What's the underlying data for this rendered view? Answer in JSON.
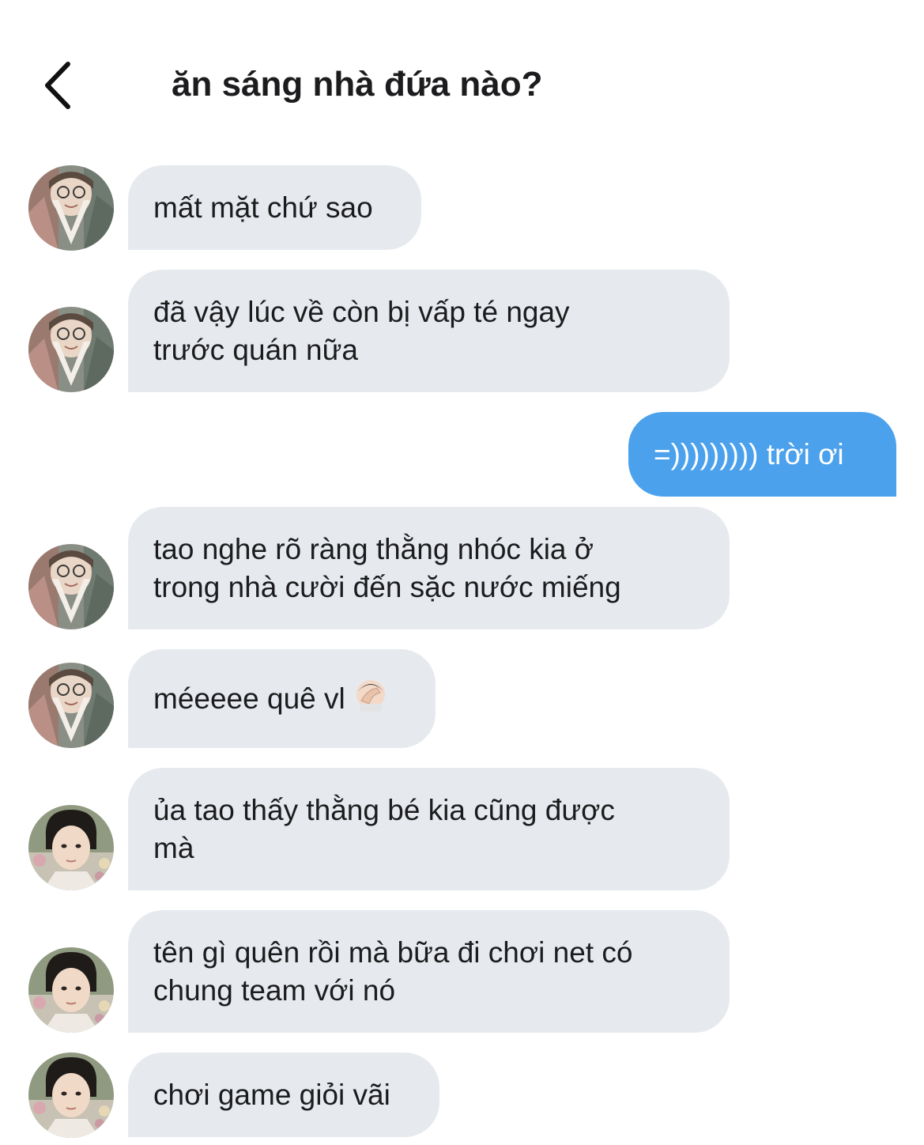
{
  "header": {
    "back_icon": "chevron-left-icon",
    "title": "ăn sáng nhà đứa nào?"
  },
  "colors": {
    "incoming_bubble": "#e6eaee",
    "outgoing_bubble": "#4ba1ec",
    "text": "#1c1c1e"
  },
  "messages": [
    {
      "sender": "friend-a",
      "direction": "incoming",
      "text": "mất mặt chứ sao"
    },
    {
      "sender": "friend-a",
      "direction": "incoming",
      "line1": "đã vậy lúc về còn bị vấp té ngay",
      "line2": "trước quán nữa"
    },
    {
      "sender": "me",
      "direction": "outgoing",
      "text": "=))))))))) trời ơi"
    },
    {
      "sender": "friend-a",
      "direction": "incoming",
      "line1": "tao nghe rõ ràng thằng nhóc kia ở",
      "line2": "trong nhà cười đến sặc nước miếng"
    },
    {
      "sender": "friend-a",
      "direction": "incoming",
      "text": "méeeee quê vl",
      "emoji": "face-palm-icon"
    },
    {
      "sender": "friend-b",
      "direction": "incoming",
      "line1": "ủa tao thấy thằng bé kia cũng được",
      "line2": "mà"
    },
    {
      "sender": "friend-b",
      "direction": "incoming",
      "line1": "tên gì quên rồi mà bữa đi chơi net có",
      "line2": "chung team với nó"
    },
    {
      "sender": "friend-b",
      "direction": "incoming",
      "text": "chơi game giỏi vãi"
    }
  ]
}
